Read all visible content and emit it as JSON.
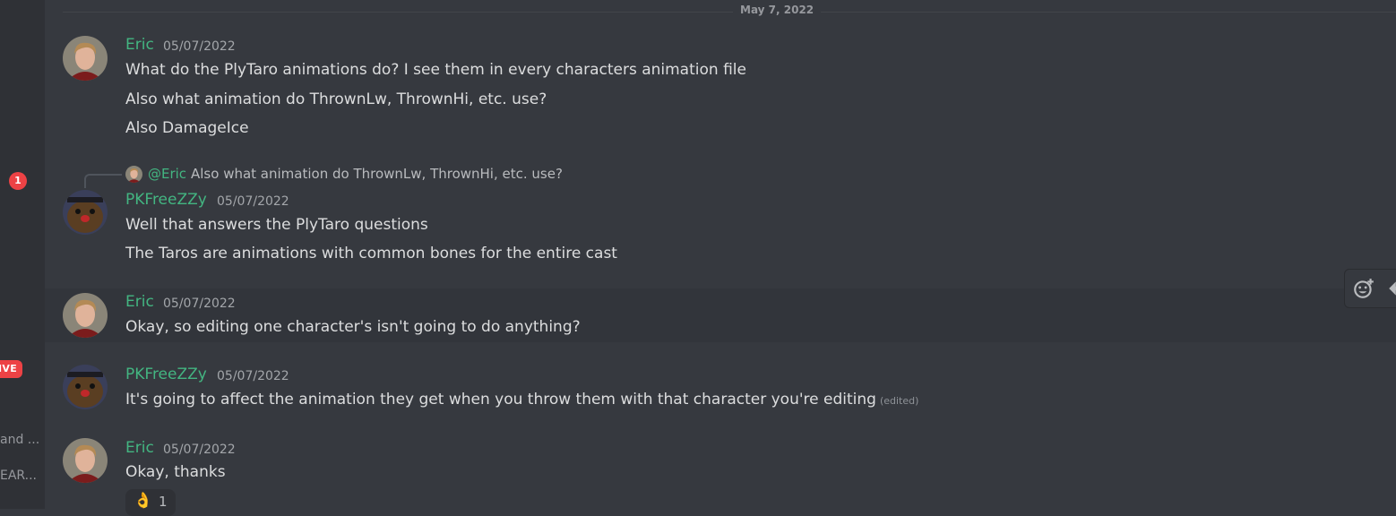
{
  "sidebar": {
    "unread_count": "1",
    "live_label": "IVE",
    "item_text_1": "and ...",
    "item_text_2": "EAR..."
  },
  "date_divider": "May 7, 2022",
  "messages": [
    {
      "author": "Eric",
      "timestamp": "05/07/2022",
      "lines": [
        "What do the PlyTaro animations do? I see them in every characters animation file",
        "Also what animation do ThrownLw, ThrownHi, etc. use?",
        "Also DamageIce"
      ]
    },
    {
      "reply": {
        "mention": "@Eric",
        "text": "Also what animation do ThrownLw, ThrownHi, etc. use?"
      },
      "author": "PKFreeZZy",
      "timestamp": "05/07/2022",
      "lines": [
        "Well that answers the PlyTaro questions",
        "The Taros are animations with common bones for the entire cast"
      ]
    },
    {
      "author": "Eric",
      "timestamp": "05/07/2022",
      "lines": [
        "Okay, so editing one character's isn't going to do anything?"
      ]
    },
    {
      "author": "PKFreeZZy",
      "timestamp": "05/07/2022",
      "lines": [
        "It's going to affect the animation they get when you throw them with that character you're editing"
      ],
      "edited_label": "(edited)"
    },
    {
      "author": "Eric",
      "timestamp": "05/07/2022",
      "lines": [
        "Okay, thanks"
      ],
      "reaction": {
        "emoji": "👌",
        "count": "1"
      }
    }
  ],
  "toolbar": {
    "icons": [
      "add-reaction-icon",
      "reply-icon"
    ]
  },
  "colors": {
    "background": "#36393f",
    "sidebar": "#2f3136",
    "username_green": "#43b581",
    "badge_red": "#ed4245"
  }
}
